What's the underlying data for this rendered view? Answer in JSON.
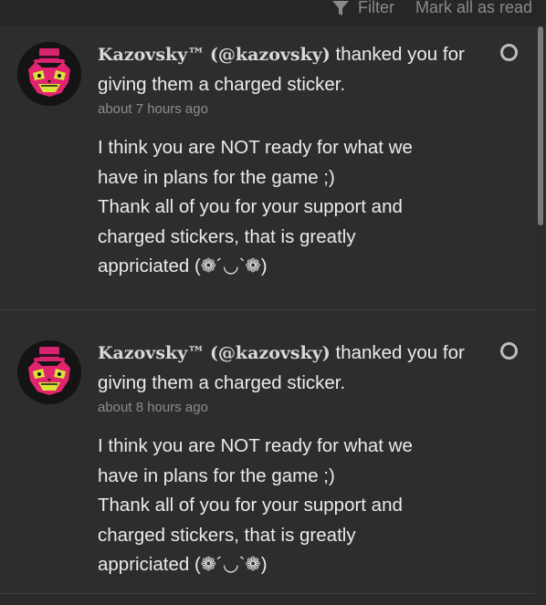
{
  "toolbar": {
    "filter_label": "Filter",
    "mark_all_label": "Mark all as read"
  },
  "notifications": [
    {
      "user_name": "Kazovsky™",
      "user_handle": "(@kazovsky)",
      "action_text": " thanked you for giving them a charged sticker.",
      "time": "about 7 hours ago",
      "message_lines": [
        "I think you are NOT ready for what we",
        "have in plans for the game ;)",
        "Thank all of you for your support and",
        "charged stickers, that is greatly",
        "appriciated (❁´◡`❁)"
      ]
    },
    {
      "user_name": "Kazovsky™",
      "user_handle": "(@kazovsky)",
      "action_text": " thanked you for giving them a charged sticker.",
      "time": "about 8 hours ago",
      "message_lines": [
        "I think you are NOT ready for what we",
        "have in plans for the game ;)",
        "Thank all of you for your support and",
        "charged stickers, that is greatly",
        "appriciated (❁´◡`❁)"
      ]
    }
  ],
  "icons": {
    "filter": "funnel-icon",
    "avatar": "cat-mascot-avatar",
    "read_toggle": "circle-outline-icon"
  },
  "colors": {
    "background": "#2b2b2b",
    "toolbar_text": "#8a8a8a",
    "primary_text": "#ebebeb",
    "secondary_text": "#8c8c8c"
  }
}
